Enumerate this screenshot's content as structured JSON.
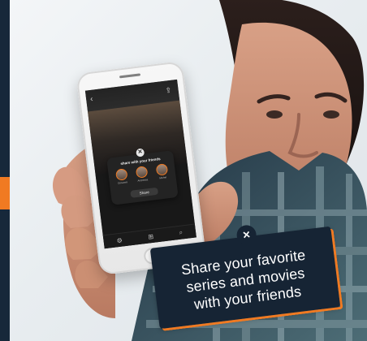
{
  "brand_colors": {
    "navy": "#162434",
    "orange": "#f07a22",
    "screen_dark": "#1e1e1f"
  },
  "phone_ui": {
    "sheet_title": "share with your friends",
    "friends": [
      {
        "name": "Giovanni"
      },
      {
        "name": "Andressa"
      },
      {
        "name": "Michel"
      }
    ],
    "share_button_label": "Share",
    "top_left_icon": "back-arrow-icon",
    "top_right_icon": "share-icon",
    "sheet_icon": "logo-badge-icon",
    "nav_icons": [
      "settings-icon",
      "add-icon",
      "search-icon"
    ]
  },
  "caption": {
    "badge_icon": "logo-badge-icon",
    "text_line_1": "Share your favorite",
    "text_line_2": "series and movies",
    "text_line_3": "with your friends"
  }
}
